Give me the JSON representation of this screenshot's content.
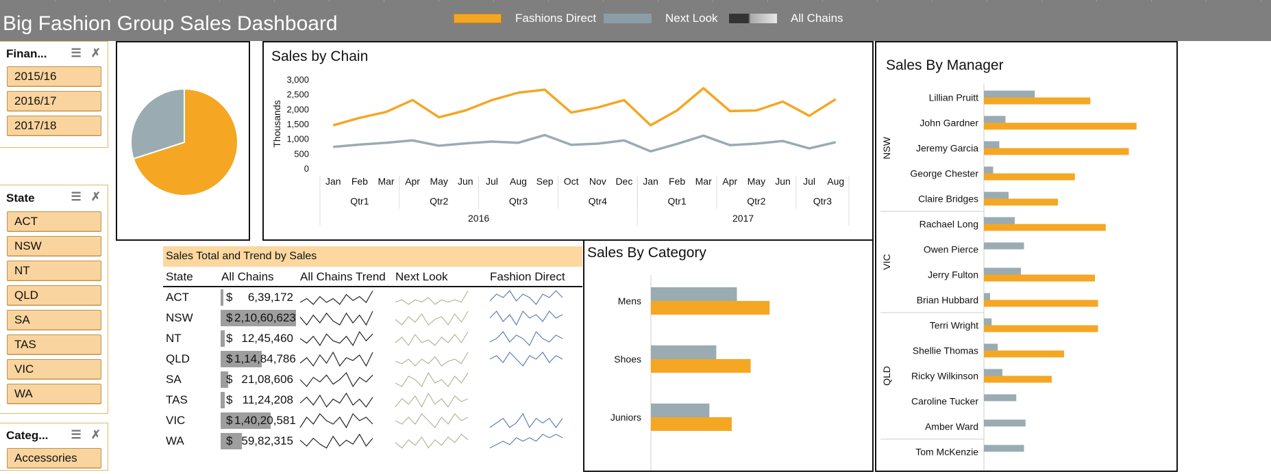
{
  "header": {
    "title": "Big Fashion Group Sales Dashboard",
    "legend": [
      {
        "label": "Fashions Direct",
        "color": "#f5a623"
      },
      {
        "label": "Next Look",
        "color": "#8b9ea7"
      },
      {
        "label": "All Chains",
        "color": "#444444"
      }
    ]
  },
  "slicers": [
    {
      "title": "Finan...",
      "items": [
        "2015/16",
        "2016/17",
        "2017/18"
      ]
    },
    {
      "title": "State",
      "items": [
        "ACT",
        "NSW",
        "NT",
        "QLD",
        "SA",
        "TAS",
        "VIC",
        "WA"
      ]
    },
    {
      "title": "Categ...",
      "items": [
        "Accessories"
      ]
    }
  ],
  "colors": {
    "orange": "#f5a623",
    "grey": "#9aabb2",
    "header": "#7f7f7f",
    "slicer": "#fad49e"
  },
  "chart_data": [
    {
      "type": "pie",
      "values": [
        70,
        30
      ],
      "colors": [
        "#f5a623",
        "#9aabb2"
      ]
    },
    {
      "type": "line",
      "title": "Sales by Chain",
      "ylabel": "Thousands",
      "ylim": [
        0,
        3000
      ],
      "yticks": [
        "0",
        "500",
        "1,000",
        "1,500",
        "2,000",
        "2,500",
        "3,000"
      ],
      "months": [
        "Jan",
        "Feb",
        "Mar",
        "Apr",
        "May",
        "Jun",
        "Jul",
        "Aug",
        "Sep",
        "Oct",
        "Nov",
        "Dec",
        "Jan",
        "Feb",
        "Mar",
        "Apr",
        "May",
        "Jun",
        "Jul",
        "Aug"
      ],
      "quarters": [
        {
          "label": "Qtr1",
          "span": 3
        },
        {
          "label": "Qtr2",
          "span": 3
        },
        {
          "label": "Qtr3",
          "span": 3
        },
        {
          "label": "Qtr4",
          "span": 3
        },
        {
          "label": "Qtr1",
          "span": 3
        },
        {
          "label": "Qtr2",
          "span": 3
        },
        {
          "label": "Qtr3",
          "span": 2
        }
      ],
      "years": [
        {
          "label": "2016",
          "span": 12
        },
        {
          "label": "2017",
          "span": 8
        }
      ],
      "series": [
        {
          "color": "#f5a623",
          "values": [
            1450,
            1700,
            1900,
            2300,
            1720,
            1950,
            2300,
            2550,
            2650,
            1880,
            2050,
            2300,
            1450,
            1950,
            2700,
            1930,
            1950,
            2250,
            1770,
            2330
          ]
        },
        {
          "color": "#9aabb2",
          "values": [
            720,
            800,
            860,
            940,
            760,
            840,
            900,
            860,
            1120,
            790,
            830,
            940,
            570,
            820,
            1100,
            780,
            830,
            920,
            670,
            880
          ]
        }
      ]
    },
    {
      "type": "bar",
      "title": "Sales By Category",
      "categories": [
        "Mens",
        "Shoes",
        "Juniors"
      ],
      "xlim": [
        0,
        100
      ],
      "series": [
        {
          "color": "#9aabb2",
          "values": [
            50,
            38,
            34
          ]
        },
        {
          "color": "#f5a623",
          "values": [
            69,
            58,
            47
          ]
        }
      ]
    },
    {
      "type": "bar",
      "title": "Sales By Manager",
      "xlim": [
        0,
        100
      ],
      "groups": [
        {
          "label": "NSW",
          "managers": [
            "Lillian Pruitt",
            "John Gardner",
            "Jeremy Garcia",
            "George Chester",
            "Claire Bridges"
          ]
        },
        {
          "label": "VIC",
          "managers": [
            "Rachael Long",
            "Owen Pierce",
            "Jerry Fulton",
            "Brian Hubbard"
          ]
        },
        {
          "label": "QLD",
          "managers": [
            "Terri Wright",
            "Shellie Thomas",
            "Ricky Wilkinson",
            "Caroline Tucker",
            "Amber Ward"
          ]
        },
        {
          "label": "",
          "managers": [
            "Tom McKenzie"
          ]
        }
      ],
      "series": [
        {
          "color": "#9aabb2",
          "values": [
            33,
            14,
            10,
            6,
            16,
            20,
            26,
            24,
            4,
            5,
            9,
            12,
            21,
            27,
            26
          ]
        },
        {
          "color": "#f5a623",
          "values": [
            69,
            99,
            94,
            59,
            48,
            79,
            0,
            72,
            74,
            74,
            52,
            44,
            0,
            0,
            0
          ]
        }
      ]
    }
  ],
  "sales_table": {
    "title": "Sales Total and Trend by Sales",
    "columns": [
      "State",
      "All Chains",
      "All Chains Trend",
      "Next Look",
      "Fashion Direct"
    ],
    "currency": "$",
    "rows": [
      {
        "state": "ACT",
        "all_chains": "6,39,172",
        "bar": 3.0,
        "has_next": true,
        "has_fashion": true
      },
      {
        "state": "NSW",
        "all_chains": "2,10,60,623",
        "bar": 100,
        "has_next": true,
        "has_fashion": true
      },
      {
        "state": "NT",
        "all_chains": "12,45,460",
        "bar": 5.9,
        "has_next": true,
        "has_fashion": true
      },
      {
        "state": "QLD",
        "all_chains": "1,14,84,786",
        "bar": 54.5,
        "has_next": true,
        "has_fashion": true
      },
      {
        "state": "SA",
        "all_chains": "21,08,606",
        "bar": 10.0,
        "has_next": true,
        "has_fashion": false
      },
      {
        "state": "TAS",
        "all_chains": "11,24,208",
        "bar": 5.3,
        "has_next": true,
        "has_fashion": false
      },
      {
        "state": "VIC",
        "all_chains": "1,40,20,581",
        "bar": 66.5,
        "has_next": true,
        "has_fashion": true
      },
      {
        "state": "WA",
        "all_chains": "59,82,315",
        "bar": 28.4,
        "has_next": true,
        "has_fashion": true
      }
    ],
    "sparklines": {
      "all": [
        [
          3,
          5,
          2,
          6,
          3,
          5,
          2,
          7,
          4,
          6,
          3,
          9
        ],
        [
          6,
          2,
          7,
          3,
          8,
          4,
          2,
          8,
          3,
          7,
          2,
          9
        ],
        [
          5,
          3,
          6,
          2,
          7,
          4,
          3,
          6,
          2,
          8,
          4,
          7
        ],
        [
          4,
          6,
          3,
          7,
          4,
          8,
          3,
          6,
          5,
          7,
          3,
          8
        ],
        [
          5,
          2,
          6,
          4,
          7,
          3,
          5,
          8,
          2,
          6,
          4,
          7
        ],
        [
          4,
          7,
          3,
          8,
          2,
          6,
          4,
          9,
          3,
          6,
          2,
          7
        ],
        [
          3,
          6,
          4,
          7,
          5,
          4,
          6,
          3,
          7,
          5,
          6,
          4
        ],
        [
          6,
          3,
          7,
          4,
          2,
          8,
          3,
          6,
          4,
          9,
          3,
          7
        ]
      ],
      "next": [
        [
          4,
          5,
          3,
          5,
          4,
          6,
          3,
          5,
          4,
          5,
          4,
          9
        ],
        [
          5,
          3,
          6,
          4,
          7,
          3,
          5,
          6,
          3,
          7,
          4,
          8
        ],
        [
          4,
          6,
          3,
          7,
          4,
          5,
          3,
          6,
          4,
          7,
          4,
          8
        ],
        [
          5,
          4,
          6,
          3,
          6,
          4,
          7,
          3,
          5,
          6,
          4,
          9
        ],
        [
          4,
          3,
          6,
          5,
          3,
          7,
          4,
          5,
          3,
          6,
          4,
          7
        ],
        [
          3,
          6,
          4,
          7,
          3,
          8,
          4,
          6,
          3,
          7,
          5,
          6
        ],
        [
          5,
          4,
          6,
          4,
          7,
          5,
          3,
          6,
          4,
          7,
          5,
          6
        ],
        [
          5,
          3,
          6,
          4,
          7,
          3,
          6,
          4,
          7,
          5,
          8,
          6
        ]
      ],
      "fashion": [
        [
          4,
          6,
          5,
          7,
          4,
          6,
          5,
          3,
          6,
          5,
          7,
          5
        ],
        [
          5,
          7,
          4,
          6,
          3,
          7,
          5,
          6,
          4,
          7,
          5,
          6
        ],
        [
          4,
          5,
          7,
          4,
          6,
          5,
          3,
          7,
          5,
          4,
          6,
          5
        ],
        [
          5,
          6,
          4,
          7,
          5,
          3,
          6,
          5,
          7,
          4,
          6,
          5
        ],
        [],
        [],
        [
          4,
          5,
          6,
          4,
          5,
          7,
          4,
          6,
          5,
          6,
          4,
          6
        ],
        [
          2,
          3,
          4,
          3,
          5,
          4,
          5,
          4,
          6,
          5,
          6,
          5
        ]
      ]
    }
  }
}
